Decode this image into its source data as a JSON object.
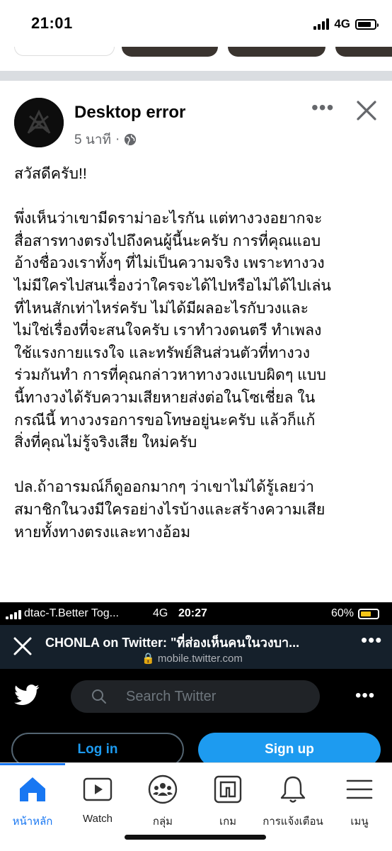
{
  "status_bar": {
    "time": "21:01",
    "network": "4G"
  },
  "post": {
    "author": "Desktop error",
    "time": "5 นาที",
    "more_icon": "more-horizontal-icon",
    "close_icon": "close-icon",
    "lines": [
      "สวัสดีครับ!!",
      "",
      "พึ่งเห็นว่าเขามีดราม่าอะไรกัน แต่ทางวงอยากจะ",
      "สื่อสารทางตรงไปถึงคนผู้นี้นะครับ การที่คุณแอบ",
      "อ้างชื่อวงเราทั้งๆ ที่ไม่เป็นความจริง เพราะทางวง",
      "ไม่มีใครไปสนเรื่องว่าใครจะได้ไปหรือไม่ได้ไปเล่น",
      "ที่ไหนสักเท่าไหร่ครับ ไม่ได้มีผลอะไรกับวงและ",
      "ไม่ใช่เรื่องที่จะสนใจครับ เราทำวงดนตรี ทำเพลง",
      "ใช้แรงกายแรงใจ และทรัพย์สินส่วนตัวที่ทางวง",
      "ร่วมกันทำ การที่คุณกล่าวหาทางวงแบบผิดๆ แบบ",
      "นี้ทางวงได้รับความเสียหายส่งต่อในโซเชี่ยล ใน",
      "กรณีนี้ ทางวงรอการขอโทษอยู่นะครับ แล้วก็แก้",
      "สิ่งที่คุณไม่รู้จริงเสีย ใหม่ครับ",
      "",
      "ปล.ถ้าอารมณ์ก็ดูออกมากๆ ว่าเขาไม่ได้รู้เลยว่า",
      "สมาชิกในวงมีใครอย่างไรบ้างและสร้างความเสีย",
      "หายทั้งทางตรงและทางอ้อม"
    ]
  },
  "embedded_screenshot": {
    "carrier": "dtac-T.Better Tog...",
    "network": "4G",
    "time": "20:27",
    "battery": "60%",
    "page_title": "CHONLA on Twitter: \"ที่ส่องเห็นคนในวงบา...",
    "url": "mobile.twitter.com",
    "search_placeholder": "Search Twitter",
    "login_label": "Log in",
    "signup_label": "Sign up",
    "accent": "#1d9bf0"
  },
  "bottom_nav": {
    "tabs": [
      {
        "label": "หน้าหลัก",
        "icon": "home-icon",
        "active": true
      },
      {
        "label": "Watch",
        "icon": "watch-icon",
        "active": false
      },
      {
        "label": "กลุ่ม",
        "icon": "groups-icon",
        "active": false
      },
      {
        "label": "เกม",
        "icon": "gaming-icon",
        "active": false
      },
      {
        "label": "การแจ้งเตือน",
        "icon": "bell-icon",
        "active": false
      },
      {
        "label": "เมนู",
        "icon": "menu-icon",
        "active": false
      }
    ],
    "active_color": "#1877f2"
  }
}
